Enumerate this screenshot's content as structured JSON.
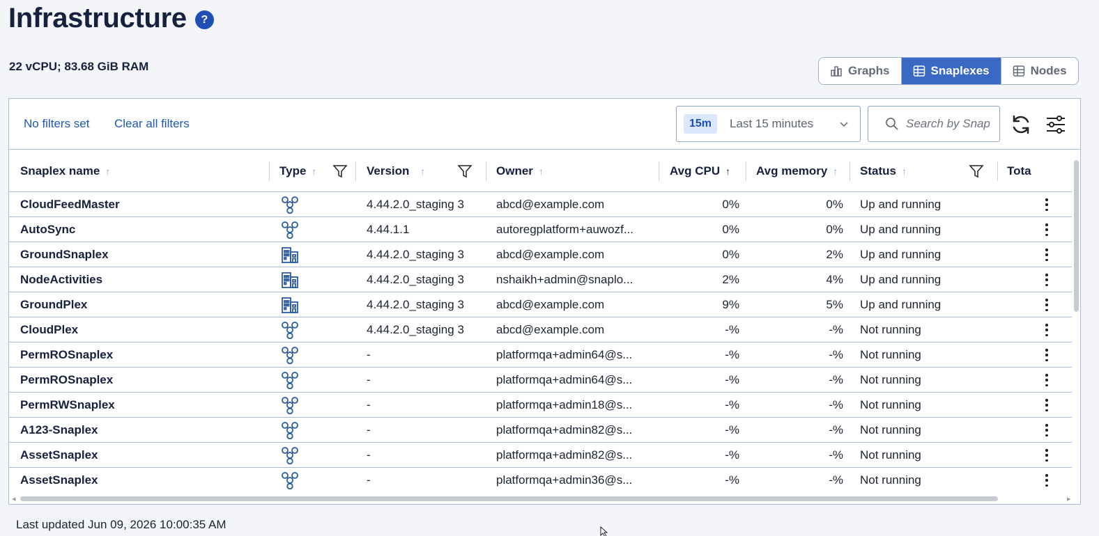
{
  "header": {
    "title": "Infrastructure",
    "help_icon": "question-circle-icon",
    "help_glyph": "?"
  },
  "resources": {
    "text": "22 vCPU; 83.68 GiB RAM"
  },
  "view_toggle": {
    "items": [
      {
        "label": "Graphs",
        "icon": "bar-chart-icon",
        "active": false
      },
      {
        "label": "Snaplexes",
        "icon": "grid-table-icon",
        "active": true
      },
      {
        "label": "Nodes",
        "icon": "grid-table-icon",
        "active": false
      }
    ]
  },
  "filters": {
    "status": "No filters set",
    "clear_label": "Clear all filters"
  },
  "time_range": {
    "chip": "15m",
    "label": "Last 15 minutes"
  },
  "search": {
    "placeholder": "Search by Snaplex name"
  },
  "table": {
    "columns": [
      {
        "label": "Snaplex name",
        "sort": "asc",
        "filter": false
      },
      {
        "label": "Type",
        "sort": "asc",
        "filter": true
      },
      {
        "label": "Version",
        "sort": "asc",
        "filter": true
      },
      {
        "label": "Owner",
        "sort": "asc",
        "filter": false
      },
      {
        "label": "Avg CPU",
        "sort": "active-asc",
        "filter": false
      },
      {
        "label": "Avg memory",
        "sort": "asc",
        "filter": false
      },
      {
        "label": "Status",
        "sort": "asc",
        "filter": true
      },
      {
        "label": "Tota",
        "sort": null,
        "filter": false
      }
    ],
    "rows": [
      {
        "name": "CloudFeedMaster",
        "type": "cloud",
        "version": "4.44.2.0_staging 3",
        "owner": "abcd@example.com",
        "cpu": "0%",
        "memory": "0%",
        "status": "Up and running"
      },
      {
        "name": "AutoSync",
        "type": "cloud",
        "version": "4.44.1.1",
        "owner": "autoregplatform+auwozf...",
        "cpu": "0%",
        "memory": "0%",
        "status": "Up and running"
      },
      {
        "name": "GroundSnaplex",
        "type": "ground",
        "version": "4.44.2.0_staging 3",
        "owner": "abcd@example.com",
        "cpu": "0%",
        "memory": "2%",
        "status": "Up and running"
      },
      {
        "name": "NodeActivities",
        "type": "ground",
        "version": "4.44.2.0_staging 3",
        "owner": "nshaikh+admin@snaplo...",
        "cpu": "2%",
        "memory": "4%",
        "status": "Up and running"
      },
      {
        "name": "GroundPlex",
        "type": "ground",
        "version": "4.44.2.0_staging 3",
        "owner": "abcd@example.com",
        "cpu": "9%",
        "memory": "5%",
        "status": "Up and running"
      },
      {
        "name": "CloudPlex",
        "type": "cloud",
        "version": "4.44.2.0_staging 3",
        "owner": "abcd@example.com",
        "cpu": "-%",
        "memory": "-%",
        "status": "Not running"
      },
      {
        "name": "PermROSnaplex",
        "type": "cloud",
        "version": "-",
        "owner": "platformqa+admin64@s...",
        "cpu": "-%",
        "memory": "-%",
        "status": "Not running"
      },
      {
        "name": "PermROSnaplex",
        "type": "cloud",
        "version": "-",
        "owner": "platformqa+admin64@s...",
        "cpu": "-%",
        "memory": "-%",
        "status": "Not running"
      },
      {
        "name": "PermRWSnaplex",
        "type": "cloud",
        "version": "-",
        "owner": "platformqa+admin18@s...",
        "cpu": "-%",
        "memory": "-%",
        "status": "Not running"
      },
      {
        "name": "A123-Snaplex",
        "type": "cloud",
        "version": "-",
        "owner": "platformqa+admin82@s...",
        "cpu": "-%",
        "memory": "-%",
        "status": "Not running"
      },
      {
        "name": "AssetSnaplex",
        "type": "cloud",
        "version": "-",
        "owner": "platformqa+admin82@s...",
        "cpu": "-%",
        "memory": "-%",
        "status": "Not running"
      },
      {
        "name": "AssetSnaplex",
        "type": "cloud",
        "version": "-",
        "owner": "platformqa+admin36@s...",
        "cpu": "-%",
        "memory": "-%",
        "status": "Not running"
      }
    ]
  },
  "footer": {
    "last_updated": "Last updated Jun 09, 2026 10:00:35 AM"
  },
  "colors": {
    "accent": "#3a69c3",
    "link": "#1f56b8",
    "icon": "#2c5aa0",
    "border": "#a9bbd6"
  }
}
